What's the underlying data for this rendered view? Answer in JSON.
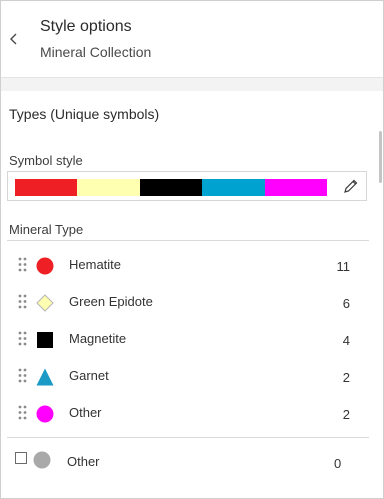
{
  "header": {
    "title": "Style options",
    "subtitle": "Mineral Collection"
  },
  "section": {
    "title": "Types (Unique symbols)"
  },
  "symbol_style": {
    "label": "Symbol style",
    "ramp_colors": [
      "#ee2026",
      "#ffffb2",
      "#000000",
      "#00a3d0",
      "#ff00ff"
    ]
  },
  "field": {
    "label": "Mineral Type"
  },
  "categories": [
    {
      "label": "Hematite",
      "count": "11",
      "shape": "circle",
      "color": "#ee2026"
    },
    {
      "label": "Green Epidote",
      "count": "6",
      "shape": "diamond",
      "color": "#ffffb2"
    },
    {
      "label": "Magnetite",
      "count": "4",
      "shape": "square",
      "color": "#000000"
    },
    {
      "label": "Garnet",
      "count": "2",
      "shape": "triangle",
      "color": "#1a9ac4"
    },
    {
      "label": "Other",
      "count": "2",
      "shape": "circle",
      "color": "#ff00ff"
    }
  ],
  "other": {
    "label": "Other",
    "count": "0",
    "shape": "circle",
    "color": "#a9a9a9",
    "checked": false
  }
}
